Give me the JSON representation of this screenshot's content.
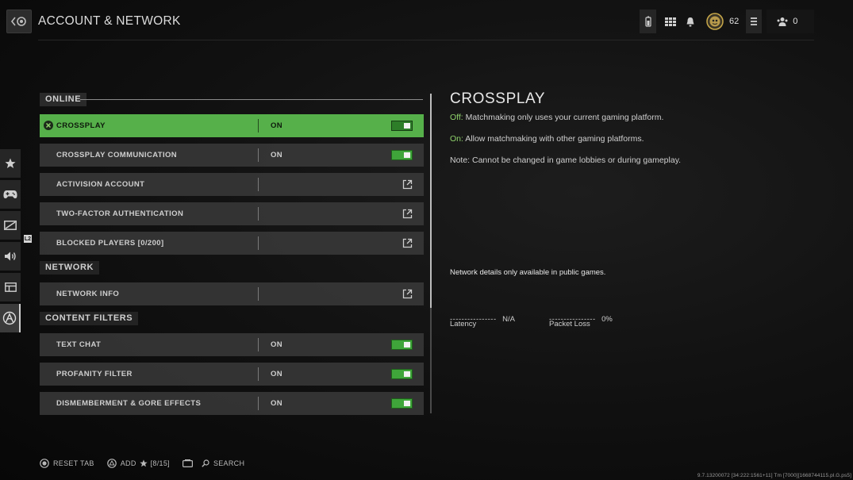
{
  "header": {
    "title": "ACCOUNT & NETWORK",
    "currency_value": "62",
    "friends_count": "0"
  },
  "rail": {
    "items": [
      "star-icon",
      "gamepad-icon",
      "display-icon",
      "speaker-icon",
      "layout-icon",
      "network-icon"
    ],
    "tag_label": "L2"
  },
  "sections": {
    "online": "ONLINE",
    "network": "NETWORK",
    "content_filters": "CONTENT FILTERS"
  },
  "rows": {
    "crossplay": {
      "label": "CROSSPLAY",
      "value": "ON"
    },
    "crossplay_comm": {
      "label": "CROSSPLAY COMMUNICATION",
      "value": "ON"
    },
    "activision": {
      "label": "ACTIVISION ACCOUNT"
    },
    "two_factor": {
      "label": "TWO-FACTOR AUTHENTICATION"
    },
    "blocked": {
      "label": "BLOCKED PLAYERS [0/200]"
    },
    "network_info": {
      "label": "NETWORK INFO"
    },
    "text_chat": {
      "label": "TEXT CHAT",
      "value": "ON"
    },
    "profanity": {
      "label": "PROFANITY FILTER",
      "value": "ON"
    },
    "gore": {
      "label": "DISMEMBERMENT & GORE EFFECTS",
      "value": "ON"
    }
  },
  "detail": {
    "title": "CROSSPLAY",
    "off_key": "Off:",
    "off_text": " Matchmaking only uses your current gaming platform.",
    "on_key": "On:",
    "on_text": " Allow matchmaking with other gaming platforms.",
    "note": "Note: Cannot be changed in game lobbies or during gameplay.",
    "network_note": "Network details only available in public games.",
    "latency_dashes": "----------------",
    "latency_value": "N/A",
    "latency_label": "Latency",
    "packet_dashes": "----------------",
    "packet_value": "0%",
    "packet_label": "Packet Loss"
  },
  "footer": {
    "reset": "RESET TAB",
    "add": "ADD",
    "add_count": "[8/15]",
    "search": "SEARCH",
    "version": "9.7.13200072 [34:222:1561+11] Tm [7000][1668744115.pl.G.ps5]"
  },
  "colors": {
    "accent_green": "#56b04a",
    "toggle_green": "#3fa53a",
    "highlight_text": "#8fd26b"
  }
}
